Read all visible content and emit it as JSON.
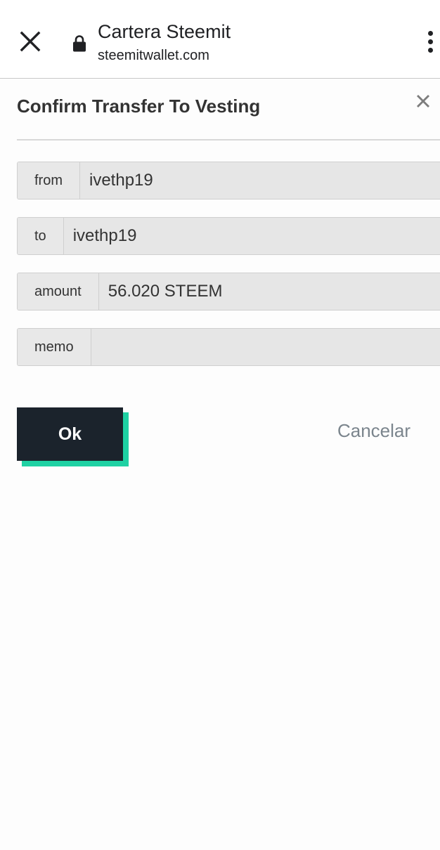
{
  "browser": {
    "site_title": "Cartera Steemit",
    "site_url": "steemitwallet.com",
    "close_icon": "close-icon",
    "lock_icon": "lock-icon",
    "menu_icon": "more-vertical-icon"
  },
  "dialog": {
    "title": "Confirm Transfer To Vesting",
    "close_icon": "close-icon",
    "fields": {
      "from": {
        "label": "from",
        "value": "ivethp19"
      },
      "to": {
        "label": "to",
        "value": "ivethp19"
      },
      "amount": {
        "label": "amount",
        "value": "56.020 STEEM"
      },
      "memo": {
        "label": "memo",
        "value": ""
      }
    },
    "ok_label": "Ok",
    "cancel_label": "Cancelar"
  },
  "colors": {
    "ok_background": "#1b232c",
    "ok_accent": "#1fd1a3",
    "cancel_text": "#7b858d"
  }
}
